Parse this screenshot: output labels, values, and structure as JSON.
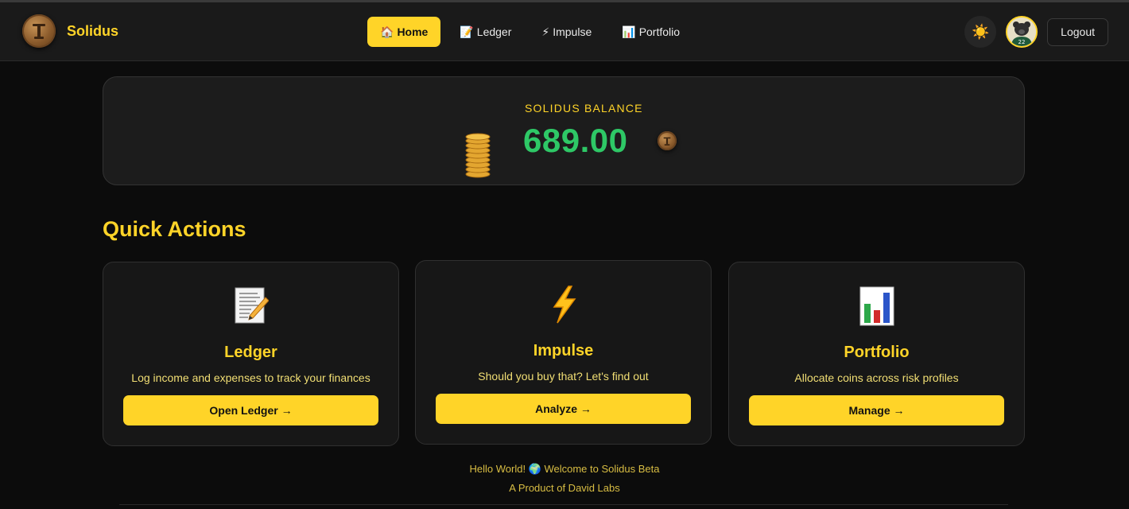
{
  "navbar": {
    "brand": "Solidus",
    "links": [
      {
        "label": "Home",
        "emoji": "🏠",
        "active": true
      },
      {
        "label": "Ledger",
        "emoji": "📝",
        "active": false
      },
      {
        "label": "Impulse",
        "emoji": "⚡",
        "active": false
      },
      {
        "label": "Portfolio",
        "emoji": "📊",
        "active": false
      }
    ],
    "theme_icon": "☀️",
    "avatar_jersey_number": "22",
    "logout_label": "Logout"
  },
  "balance": {
    "label": "SOLIDUS BALANCE",
    "value": "689.00"
  },
  "quick_actions": {
    "title": "Quick Actions",
    "cards": [
      {
        "emoji": "📝",
        "title": "Ledger",
        "description": "Log income and expenses to track your finances",
        "button": "Open Ledger →"
      },
      {
        "emoji": "⚡",
        "title": "Impulse",
        "description": "Should you buy that? Let's find out",
        "button": "Analyze →"
      },
      {
        "emoji": "📊",
        "title": "Portfolio",
        "description": "Allocate coins across risk profiles",
        "button": "Manage →"
      }
    ]
  },
  "footer": {
    "line1": "Hello World! 🌍 Welcome to Solidus Beta",
    "line2": "A Product of David Labs"
  },
  "colors": {
    "accent": "#ffd428",
    "balance_green": "#2ec866",
    "background": "#0c0c0c",
    "card": "#1c1c1c"
  }
}
